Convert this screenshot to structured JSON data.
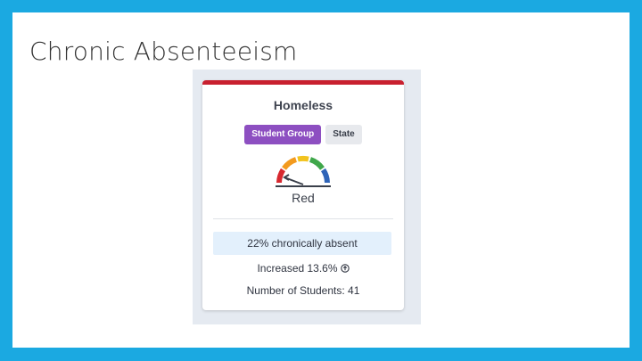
{
  "slide": {
    "title": "Chronic Absenteeism"
  },
  "card": {
    "title": "Homeless",
    "tabs": [
      {
        "label": "Student Group",
        "active": true
      },
      {
        "label": "State",
        "active": false
      }
    ],
    "gauge": {
      "status": "Red",
      "segment_colors": [
        "#d7282f",
        "#f39a1e",
        "#f2c31e",
        "#3fa74a",
        "#2f64b8"
      ],
      "accent_color": "#c8202f"
    },
    "rate_text": "22% chronically absent",
    "change_text": "Increased 13.6%",
    "change_icon": "arrow-up-circle-icon",
    "students_text": "Number of Students: 41"
  },
  "colors": {
    "background": "#1ba9e1",
    "tab_active": "#8d4fc1",
    "stat_box": "#e3f0fc"
  }
}
